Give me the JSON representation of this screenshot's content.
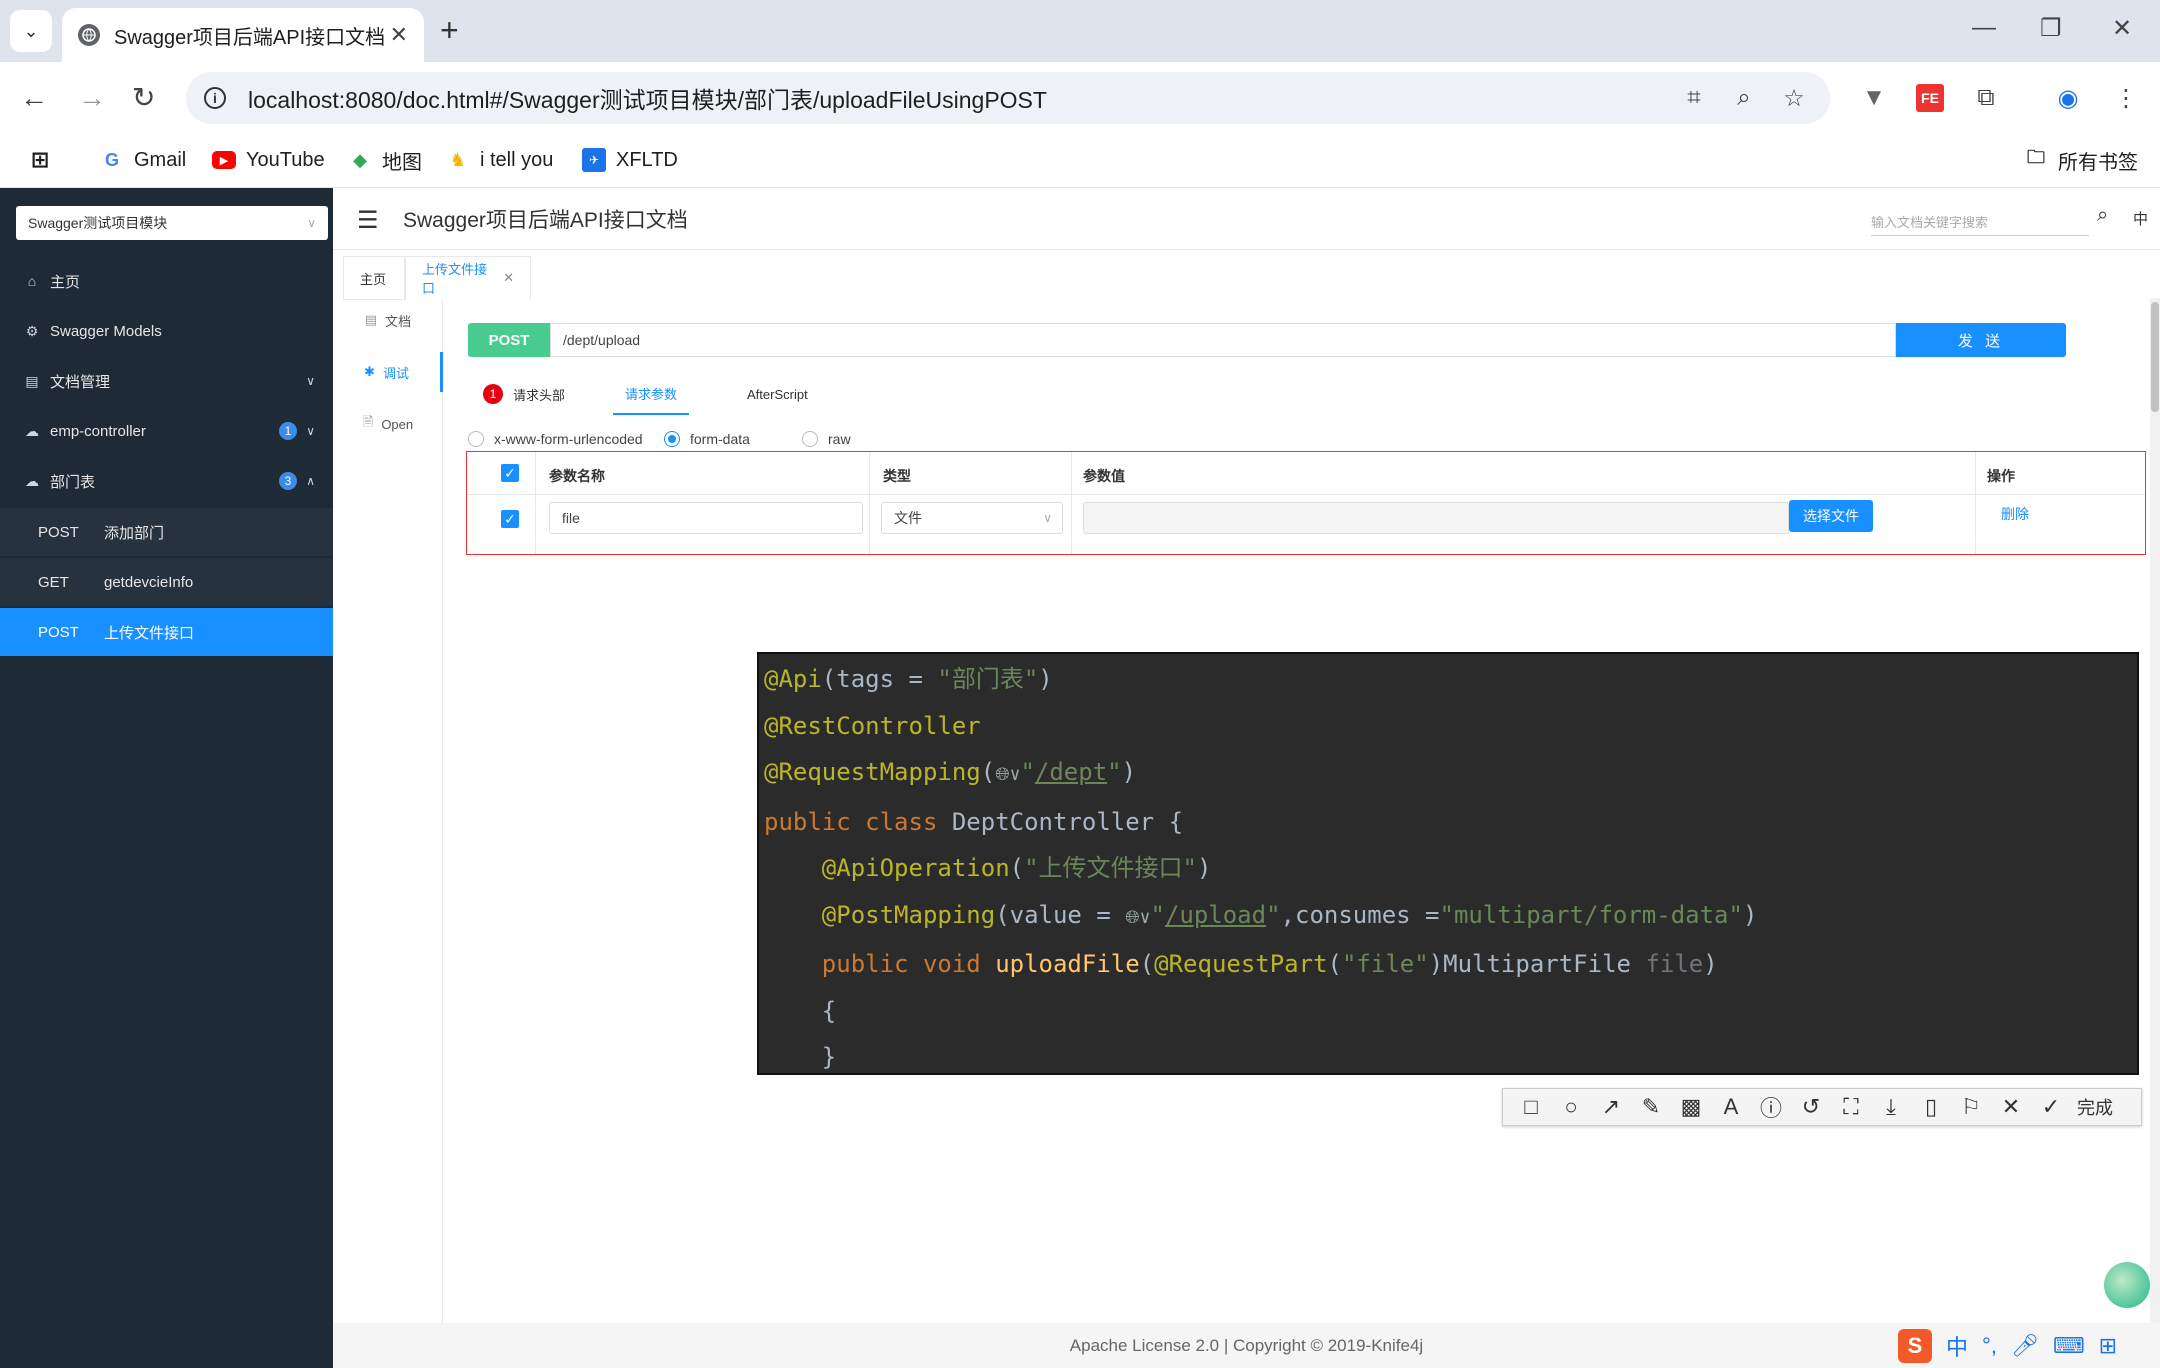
{
  "browser": {
    "tab_title": "Swagger项目后端API接口文档",
    "tab_close": "✕",
    "new_tab": "+",
    "url": "localhost:8080/doc.html#/Swagger测试项目模块/部门表/uploadFileUsingPOST",
    "bookmarks": [
      {
        "label": "Gmail",
        "icon": "google-icon"
      },
      {
        "label": "YouTube",
        "icon": "youtube-icon"
      },
      {
        "label": "地图",
        "icon": "maps-icon"
      },
      {
        "label": "i tell you",
        "icon": "itellyou-icon"
      },
      {
        "label": "XFLTD",
        "icon": "xfltd-icon"
      }
    ],
    "all_bookmarks": "所有书签"
  },
  "sidebar": {
    "module_select": "Swagger测试项目模块",
    "items": [
      {
        "label": "主页",
        "icon": "home-icon"
      },
      {
        "label": "Swagger Models",
        "icon": "models-icon"
      },
      {
        "label": "文档管理",
        "icon": "docs-icon"
      },
      {
        "label": "emp-controller",
        "icon": "cloud-icon",
        "badge": "1"
      },
      {
        "label": "部门表",
        "icon": "cloud-icon",
        "badge": "3"
      }
    ],
    "sub_items": [
      {
        "method": "POST",
        "name": "添加部门"
      },
      {
        "method": "GET",
        "name": "getdevcieInfo"
      },
      {
        "method": "POST",
        "name": "上传文件接口"
      }
    ]
  },
  "header": {
    "title": "Swagger项目后端API接口文档",
    "search_placeholder": "输入文档关键字搜索",
    "lang": "中"
  },
  "page_tabs": [
    {
      "label": "主页"
    },
    {
      "label": "上传文件接口",
      "close": "✕"
    }
  ],
  "strip": [
    {
      "label": "文档"
    },
    {
      "label": "调试"
    },
    {
      "label": "Open"
    }
  ],
  "request": {
    "method": "POST",
    "path": "/dept/upload",
    "send": "发 送"
  },
  "sub_tabs": {
    "headers_badge": "1",
    "headers": "请求头部",
    "params": "请求参数",
    "after": "AfterScript"
  },
  "content_types": [
    "x-www-form-urlencoded",
    "form-data",
    "raw"
  ],
  "table": {
    "headers": [
      "参数名称",
      "类型",
      "参数值",
      "操作"
    ],
    "row": {
      "name": "file",
      "type": "文件",
      "value": "",
      "choose": "选择文件",
      "action": "删除"
    }
  },
  "code": {
    "lines": [
      "@Api(tags = \"部门表\")",
      "@RestController",
      "@RequestMapping(\"/dept\")",
      "public class DeptController {",
      "@ApiOperation(\"上传文件接口\")",
      "@PostMapping(value = \"/upload\",consumes =\"multipart/form-data\")",
      "public void uploadFile(@RequestPart(\"file\")MultipartFile file)",
      "{",
      "}"
    ]
  },
  "screenshot_tool": {
    "done": "完成"
  },
  "footer": {
    "text": "Apache License 2.0 | Copyright © 2019-Knife4j"
  }
}
